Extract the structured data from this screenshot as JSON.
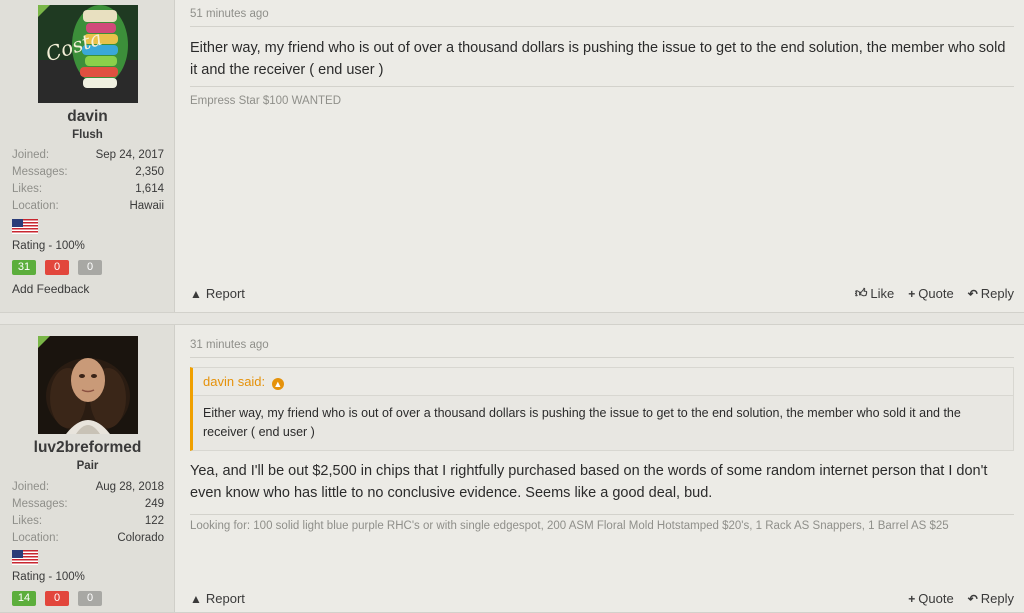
{
  "colors": {
    "online_indicator": "#7ab648",
    "badge_positive": "#5cae3c",
    "badge_negative": "#e2463c",
    "badge_neutral": "#a8a8a4",
    "quote_accent": "#e5920b"
  },
  "posts": [
    {
      "user": {
        "username": "davin",
        "title": "Flush",
        "stats": [
          {
            "label": "Joined:",
            "value": "Sep 24, 2017"
          },
          {
            "label": "Messages:",
            "value": "2,350"
          },
          {
            "label": "Likes:",
            "value": "1,614"
          },
          {
            "label": "Location:",
            "value": "Hawaii"
          }
        ],
        "flag_icon": "us-flag-icon",
        "rating": "Rating - 100%",
        "feedback": {
          "positive": "31",
          "negative": "0",
          "neutral": "0"
        },
        "add_feedback": "Add Feedback"
      },
      "timestamp": "51 minutes ago",
      "message": "Either way, my friend who is out of over a thousand dollars is pushing the issue to get to the end solution, the member who sold it and the receiver ( end user )",
      "signature": "Empress Star $100 WANTED",
      "actions": {
        "report": "Report",
        "like": "Like",
        "quote": "Quote",
        "reply": "Reply"
      }
    },
    {
      "user": {
        "username": "luv2breformed",
        "title": "Pair",
        "stats": [
          {
            "label": "Joined:",
            "value": "Aug 28, 2018"
          },
          {
            "label": "Messages:",
            "value": "249"
          },
          {
            "label": "Likes:",
            "value": "122"
          },
          {
            "label": "Location:",
            "value": "Colorado"
          }
        ],
        "flag_icon": "us-flag-icon",
        "rating": "Rating - 100%",
        "feedback": {
          "positive": "14",
          "negative": "0",
          "neutral": "0"
        }
      },
      "timestamp": "31 minutes ago",
      "quote": {
        "author": "davin said:",
        "text": "Either way, my friend who is out of over a thousand dollars is pushing the issue to get to the end solution, the member who sold it and the receiver ( end user )"
      },
      "message": "Yea, and I'll be out $2,500 in chips that I rightfully purchased based on the words of some random internet person that I don't even know who has little to no conclusive evidence. Seems like a good deal, bud.",
      "signature": "Looking for: 100 solid light blue purple RHC's or with single edgespot, 200 ASM Floral Mold Hotstamped $20's, 1 Rack AS Snappers, 1 Barrel AS $25",
      "actions": {
        "report": "Report",
        "quote": "Quote",
        "reply": "Reply"
      }
    }
  ]
}
